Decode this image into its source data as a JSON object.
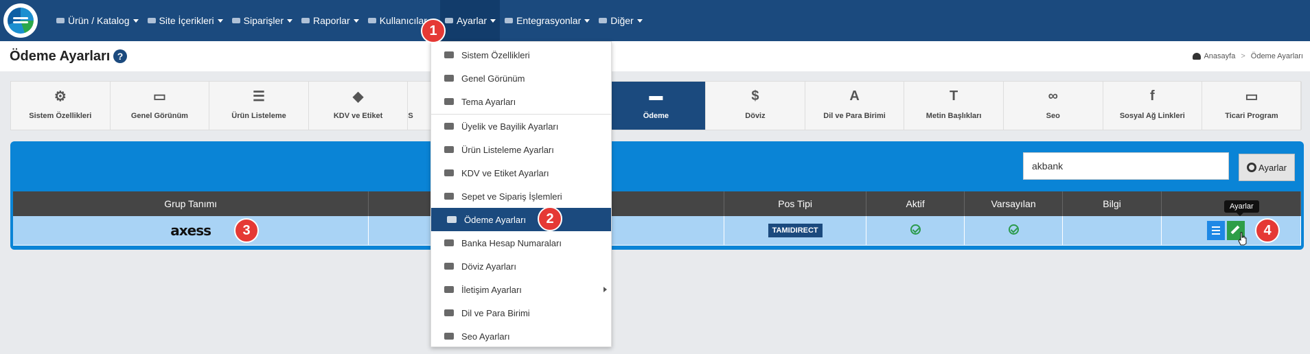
{
  "nav": {
    "items": [
      {
        "label": "Ürün / Katalog",
        "icon": "boxes-icon"
      },
      {
        "label": "Site İçerikleri",
        "icon": "files-icon"
      },
      {
        "label": "Siparişler",
        "icon": "truck-icon"
      },
      {
        "label": "Raporlar",
        "icon": "report-icon"
      },
      {
        "label": "Kullanıcılar",
        "icon": "users-icon"
      },
      {
        "label": "Ayarlar",
        "icon": "cogs-icon"
      },
      {
        "label": "Entegrasyonlar",
        "icon": "network-icon"
      },
      {
        "label": "Diğer",
        "icon": "grid-icon"
      }
    ]
  },
  "header": {
    "title": "Ödeme Ayarları",
    "help": "?",
    "breadcrumb": {
      "home": "Anasayfa",
      "sep": ">",
      "current": "Ödeme Ayarları"
    }
  },
  "tabs": [
    {
      "label": "Sistem Özellikleri",
      "icon": "cogs-icon"
    },
    {
      "label": "Genel Görünüm",
      "icon": "monitor-icon"
    },
    {
      "label": "Ürün Listeleme",
      "icon": "list-icon"
    },
    {
      "label": "KDV ve Etiket",
      "icon": "tags-icon"
    },
    {
      "label": "S",
      "icon": "basket-icon"
    },
    {
      "label": "",
      "icon": "bank-icon"
    },
    {
      "label": "Ödeme",
      "icon": "credit-card-icon"
    },
    {
      "label": "Döviz",
      "icon": "dollar-icon"
    },
    {
      "label": "Dil ve Para Birimi",
      "icon": "language-icon"
    },
    {
      "label": "Metin Başlıkları",
      "icon": "text-height-icon"
    },
    {
      "label": "Seo",
      "icon": "link-icon"
    },
    {
      "label": "Sosyal Ağ Linkleri",
      "icon": "facebook-icon"
    },
    {
      "label": "Ticari Program",
      "icon": "desktop-code-icon"
    }
  ],
  "panel": {
    "search_value": "akbank",
    "ayarlar_label": "Ayarlar",
    "columns": [
      "Grup Tanımı",
      "",
      "Pos Tipi",
      "Aktif",
      "Varsayılan",
      "Bilgi",
      ""
    ],
    "row": {
      "group": "axess",
      "pos_type": "TAMIDIRECT"
    },
    "tooltip": "Ayarlar"
  },
  "dropdown": {
    "items": [
      {
        "label": "Sistem Özellikleri",
        "icon": "cogs-icon"
      },
      {
        "label": "Genel Görünüm",
        "icon": "monitor-icon"
      },
      {
        "label": "Tema Ayarları",
        "icon": "brush-icon"
      },
      {
        "label": "Üyelik ve Bayilik Ayarları",
        "icon": "users-icon"
      },
      {
        "label": "Ürün Listeleme Ayarları",
        "icon": "list-icon"
      },
      {
        "label": "KDV ve Etiket Ayarları",
        "icon": "tags-icon"
      },
      {
        "label": "Sepet ve Sipariş İşlemleri",
        "icon": "basket-icon"
      },
      {
        "label": "Ödeme Ayarları",
        "icon": "credit-card-icon"
      },
      {
        "label": "Banka Hesap Numaraları",
        "icon": "bank-icon"
      },
      {
        "label": "Döviz Ayarları",
        "icon": "dollar-icon"
      },
      {
        "label": "İletişim Ayarları",
        "icon": "comments-icon"
      },
      {
        "label": "Dil ve Para Birimi",
        "icon": "language-icon"
      },
      {
        "label": "Seo Ayarları",
        "icon": "link-icon"
      }
    ]
  },
  "markers": [
    "1",
    "2",
    "3",
    "4"
  ],
  "colors": {
    "navbar": "#1b4a7e",
    "panel": "#0a84d6",
    "row": "#a9d3f5",
    "marker": "#e53935"
  }
}
